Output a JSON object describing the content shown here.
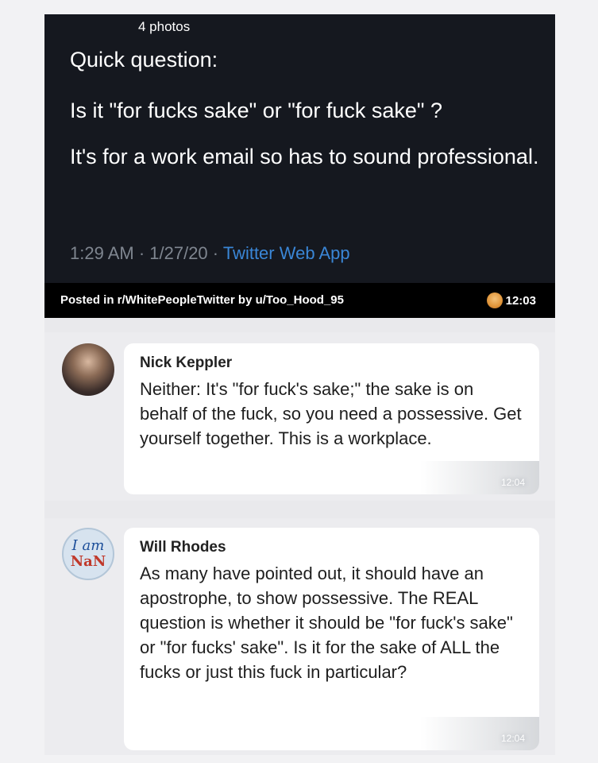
{
  "tweet": {
    "photos_label": "4 photos",
    "line_question": "Quick question:",
    "line_body1": "Is it \"for fucks sake\" or \"for fuck sake\" ?",
    "line_body2": "It's for a work email so has to sound professional.",
    "meta_time": "1:29 AM · 1/27/20 · ",
    "meta_app": "Twitter Web App"
  },
  "posted_bar": {
    "text": "Posted in r/WhitePeopleTwitter by u/Too_Hood_95",
    "time": "12:03",
    "icon": "emoji-face-icon"
  },
  "messages": [
    {
      "sender": "Nick Keppler",
      "text": "Neither: It's \"for fuck's sake;\" the sake is on behalf of the fuck, so you need a possessive. Get yourself together. This is a workplace.",
      "time": "12:04"
    },
    {
      "sender": "Will Rhodes",
      "avatar_line1": "I am",
      "avatar_line2": "NaN",
      "text": "As many have pointed out, it should have an apostrophe, to show possessive. The REAL question is whether it should be \"for fuck's sake\" or \"for fucks' sake\". Is it for the sake of ALL the fucks or just this fuck in particular?",
      "time": "12:04"
    }
  ]
}
